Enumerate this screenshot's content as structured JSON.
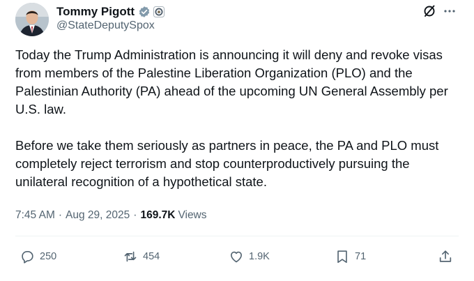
{
  "author": {
    "display_name": "Tommy Pigott",
    "handle": "@StateDeputySpox",
    "verified_badge_icon": "verified-badge-icon",
    "affiliation_icon": "government-seal-icon",
    "badge_color": "#829aab"
  },
  "header_actions": {
    "grok_icon": "grok-icon",
    "more_icon": "more-icon"
  },
  "tweet": {
    "text": "Today the Trump Administration is announcing it will deny and revoke visas from members of the Palestine Liberation Organization (PLO) and the Palestinian Authority (PA) ahead of the upcoming UN General Assembly per U.S. law.\n\nBefore we take them seriously as partners in peace, the PA and PLO must completely reject terrorism and stop counterproductively pursuing the unilateral recognition of a hypothetical state."
  },
  "meta": {
    "time": "7:45 AM",
    "separator": "·",
    "date": "Aug 29, 2025",
    "views_count": "169.7K",
    "views_label": "Views"
  },
  "actions": {
    "reply_count": "250",
    "repost_count": "454",
    "like_count": "1.9K",
    "bookmark_count": "71"
  },
  "colors": {
    "text_primary": "#0f1419",
    "text_secondary": "#536471",
    "divider": "#eff3f4"
  }
}
